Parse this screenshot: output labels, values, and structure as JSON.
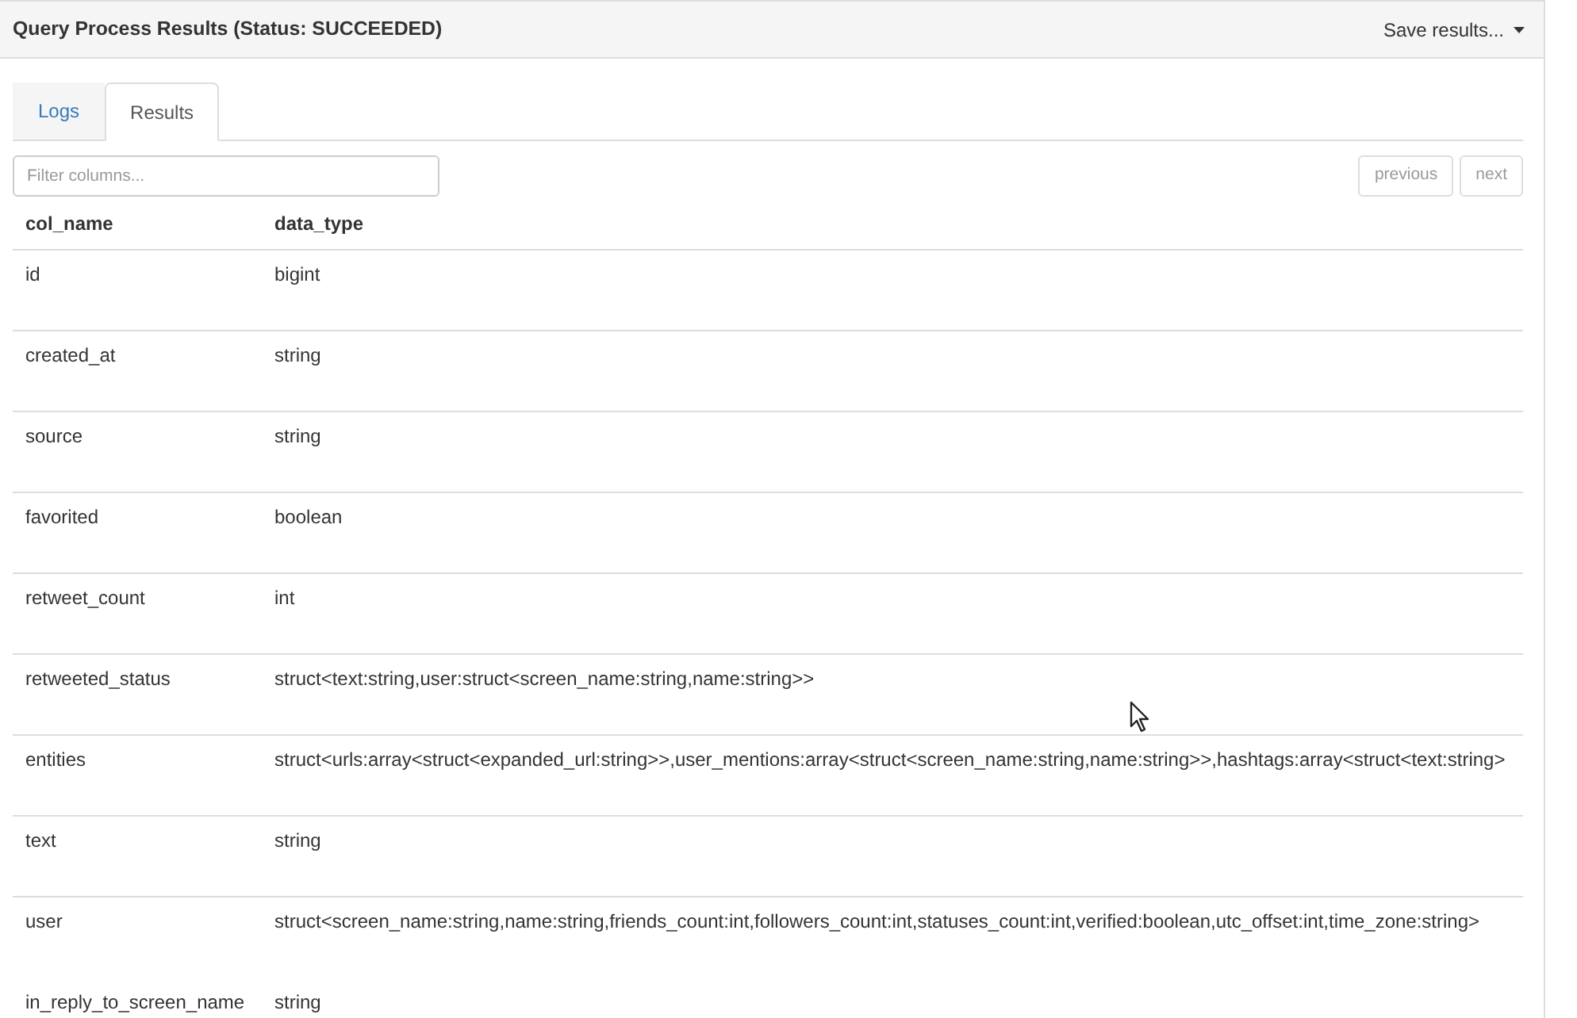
{
  "panel": {
    "title": "Query Process Results (Status: SUCCEEDED)",
    "save_menu": {
      "label": "Save results..."
    }
  },
  "tabs": [
    {
      "label": "Logs",
      "selected": false
    },
    {
      "label": "Results",
      "selected": true
    }
  ],
  "filter": {
    "placeholder": "Filter columns..."
  },
  "pager": [
    {
      "label": "previous",
      "disabled": true
    },
    {
      "label": "next",
      "disabled": true
    }
  ],
  "table": {
    "columns": [
      "col_name",
      "data_type"
    ],
    "rows": [
      [
        "id",
        "bigint"
      ],
      [
        "created_at",
        "string"
      ],
      [
        "source",
        "string"
      ],
      [
        "favorited",
        "boolean"
      ],
      [
        "retweet_count",
        "int"
      ],
      [
        "retweeted_status",
        "struct<text:string,user:struct<screen_name:string,name:string>>"
      ],
      [
        "entities",
        "struct<urls:array<struct<expanded_url:string>>,user_mentions:array<struct<screen_name:string,name:string>>,hashtags:array<struct<text:string>"
      ],
      [
        "text",
        "string"
      ],
      [
        "user",
        "struct<screen_name:string,name:string,friends_count:int,followers_count:int,statuses_count:int,verified:boolean,utc_offset:int,time_zone:string>"
      ],
      [
        "in_reply_to_screen_name",
        "string"
      ]
    ]
  }
}
